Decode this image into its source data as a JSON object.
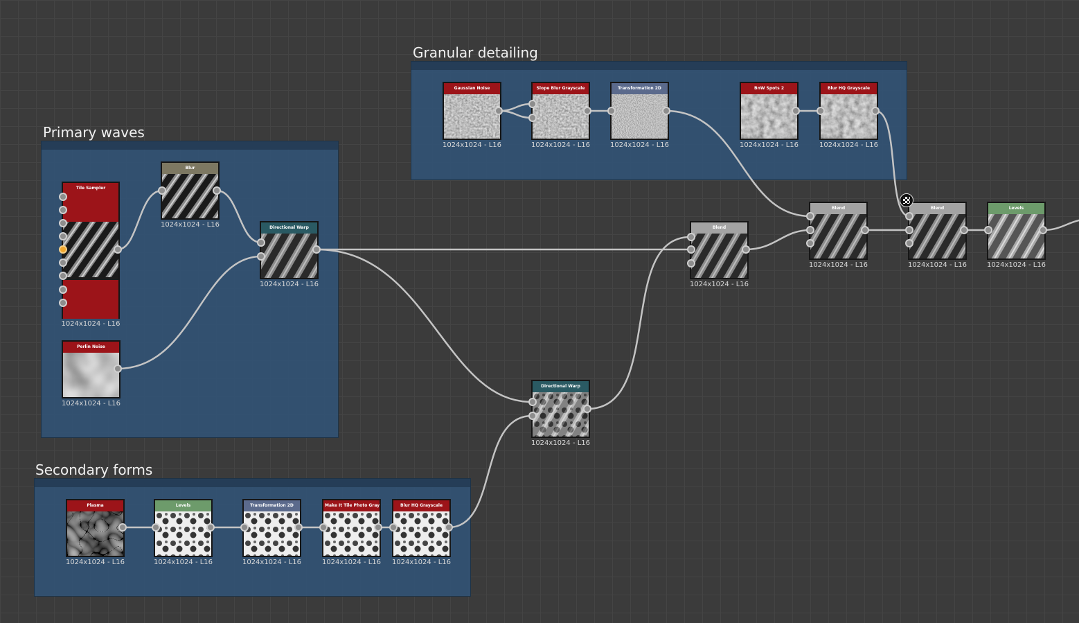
{
  "frames": {
    "granular": {
      "title": "Granular detailing"
    },
    "primary": {
      "title": "Primary waves"
    },
    "secondary": {
      "title": "Secondary forms"
    }
  },
  "colors": {
    "generator": "#9c1419",
    "filter_gray": "#a3a3a3",
    "warp": "#2a5a63",
    "levels": "#6d9b6b",
    "transform": "#5b6a8c",
    "blur": "#7d7862",
    "frame_fill": "#325273",
    "wire": "#c4c4c4",
    "port_active": "#f0a830"
  },
  "nodes": {
    "tile_sampler": {
      "title": "Tile Sampler",
      "resolution": "1024x1024 - L16"
    },
    "blur": {
      "title": "Blur",
      "resolution": "1024x1024 - L16"
    },
    "dir_warp_1": {
      "title": "Directional Warp",
      "resolution": "1024x1024 - L16"
    },
    "perlin_noise": {
      "title": "Perlin Noise",
      "resolution": "1024x1024 - L16"
    },
    "gaussian_noise": {
      "title": "Gaussian Noise",
      "resolution": "1024x1024 - L16"
    },
    "slope_blur": {
      "title": "Slope Blur Grayscale",
      "resolution": "1024x1024 - L16"
    },
    "transform_2d_a": {
      "title": "Transformation 2D",
      "resolution": "1024x1024 - L16"
    },
    "bnw_spots": {
      "title": "BnW Spots 2",
      "resolution": "1024x1024 - L16"
    },
    "blur_hq_a": {
      "title": "Blur HQ Grayscale",
      "resolution": "1024x1024 - L16"
    },
    "blend_1": {
      "title": "Blend",
      "resolution": "1024x1024 - L16"
    },
    "blend_2": {
      "title": "Blend",
      "resolution": "1024x1024 - L16"
    },
    "blend_3": {
      "title": "Blend",
      "resolution": "1024x1024 - L16"
    },
    "levels_out": {
      "title": "Levels",
      "resolution": "1024x1024 - L16"
    },
    "dir_warp_2": {
      "title": "Directional Warp",
      "resolution": "1024x1024 - L16"
    },
    "plasma": {
      "title": "Plasma",
      "resolution": "1024x1024 - L16"
    },
    "levels_b": {
      "title": "Levels",
      "resolution": "1024x1024 - L16"
    },
    "transform_2d_b": {
      "title": "Transformation 2D",
      "resolution": "1024x1024 - L16"
    },
    "make_tile": {
      "title": "Make It Tile Photo Grays...",
      "resolution": "1024x1024 - L16"
    },
    "blur_hq_b": {
      "title": "Blur HQ Grayscale",
      "resolution": "1024x1024 - L16"
    }
  },
  "icons": {
    "output_lock": "checker-icon"
  }
}
